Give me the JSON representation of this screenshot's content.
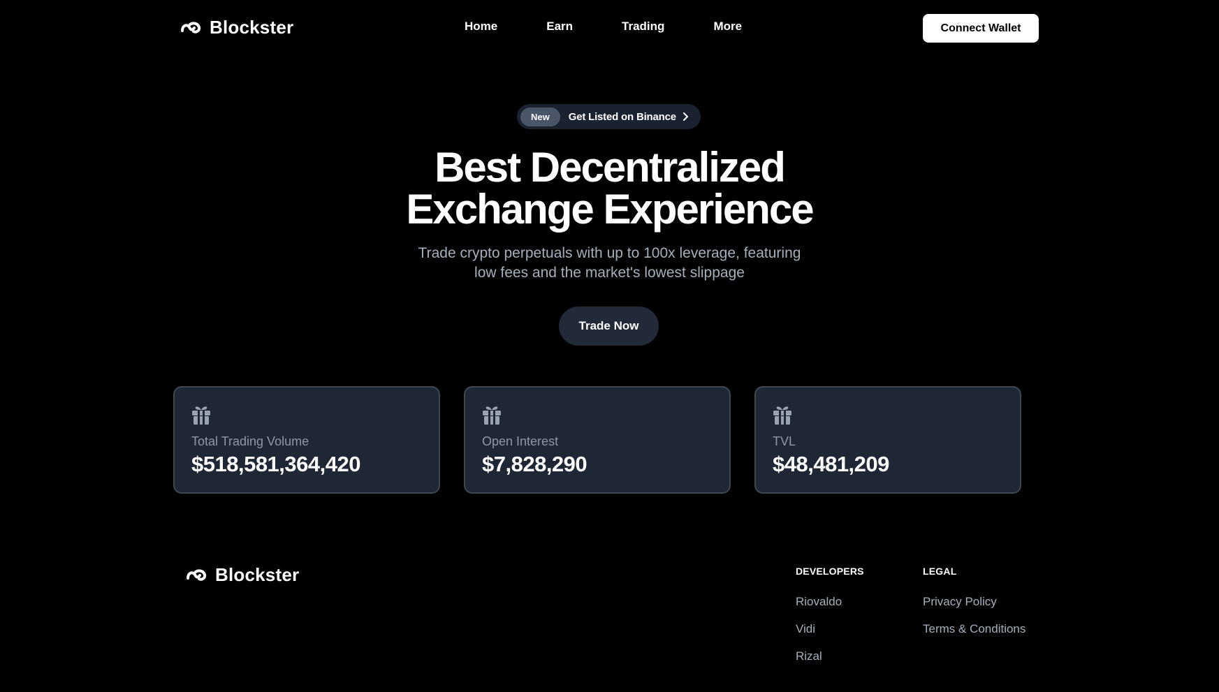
{
  "header": {
    "brand": "Blockster",
    "nav": [
      "Home",
      "Earn",
      "Trading",
      "More"
    ],
    "connect_label": "Connect Wallet"
  },
  "hero": {
    "badge": "New",
    "announcement": "Get Listed on Binance",
    "title_line1": "Best Decentralized",
    "title_line2": "Exchange Experience",
    "subtitle_line1": "Trade crypto perpetuals with up to 100x leverage, featuring",
    "subtitle_line2": "low fees and the market's lowest slippage",
    "cta_label": "Trade Now"
  },
  "stats": [
    {
      "label": "Total Trading Volume",
      "value": "$518,581,364,420",
      "icon": "gift-icon"
    },
    {
      "label": "Open Interest",
      "value": "$7,828,290",
      "icon": "gift-icon"
    },
    {
      "label": "TVL",
      "value": "$48,481,209",
      "icon": "gift-icon"
    }
  ],
  "footer": {
    "brand": "Blockster",
    "developers": {
      "heading": "DEVELOPERS",
      "links": [
        "Riovaldo",
        "Vidi",
        "Rizal"
      ]
    },
    "legal": {
      "heading": "LEGAL",
      "links": [
        "Privacy Policy",
        "Terms & Conditions"
      ]
    }
  },
  "colors": {
    "background": "#000000",
    "card_bg": "#1f2735",
    "card_border": "#3d4756",
    "muted_text": "#a6afbd",
    "pill_bg": "#1a2230"
  }
}
